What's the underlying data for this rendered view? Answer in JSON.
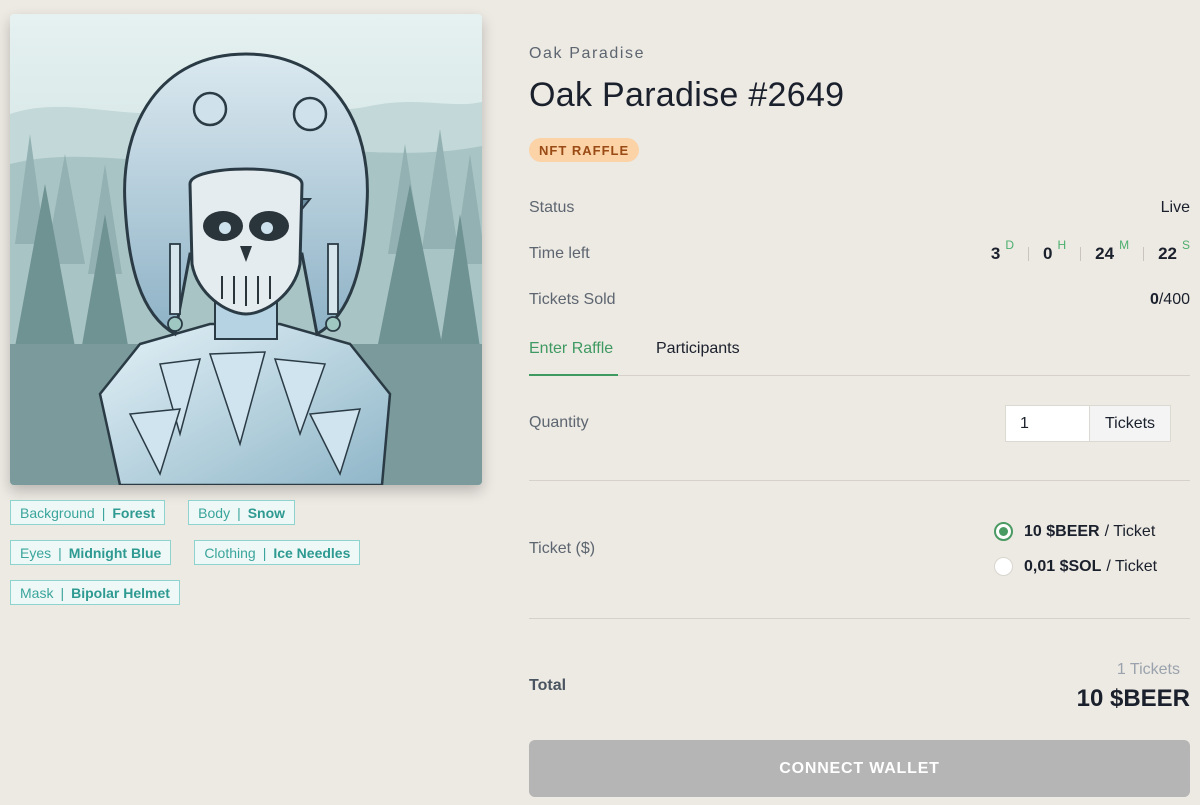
{
  "artwork": {
    "description_icon": "nft-artwork"
  },
  "traits": [
    {
      "trait_type": "Background",
      "value": "Forest"
    },
    {
      "trait_type": "Body",
      "value": "Snow"
    },
    {
      "trait_type": "Eyes",
      "value": "Midnight Blue"
    },
    {
      "trait_type": "Clothing",
      "value": "Ice Needles"
    },
    {
      "trait_type": "Mask",
      "value": "Bipolar Helmet"
    }
  ],
  "trait_separator": "|",
  "collection": "Oak Paradise",
  "title": "Oak Paradise #2649",
  "badge": "NFT RAFFLE",
  "status": {
    "label": "Status",
    "value": "Live"
  },
  "time_left": {
    "label": "Time left",
    "days": "3",
    "days_unit": "D",
    "hours": "0",
    "hours_unit": "H",
    "minutes": "24",
    "minutes_unit": "M",
    "seconds": "22",
    "seconds_unit": "S"
  },
  "tickets_sold": {
    "label": "Tickets Sold",
    "sold": "0",
    "total": "/400"
  },
  "tabs": [
    {
      "label": "Enter Raffle",
      "active": true
    },
    {
      "label": "Participants",
      "active": false
    }
  ],
  "quantity": {
    "label": "Quantity",
    "value": "1",
    "addon": "Tickets"
  },
  "ticket_price": {
    "label": "Ticket ($)",
    "options": [
      {
        "amount": "10 $BEER",
        "suffix": "/ Ticket",
        "selected": true
      },
      {
        "amount": "0,01 $SOL",
        "suffix": "/ Ticket",
        "selected": false
      }
    ]
  },
  "total": {
    "label": "Total",
    "count": "1 Tickets",
    "amount": "10 $BEER"
  },
  "connect_button": "CONNECT WALLET",
  "colors": {
    "accent_green": "#3f9a62",
    "badge_bg": "#fbd3a6",
    "trait_teal": "#3aa59c",
    "button_disabled": "#b5b5b5"
  }
}
